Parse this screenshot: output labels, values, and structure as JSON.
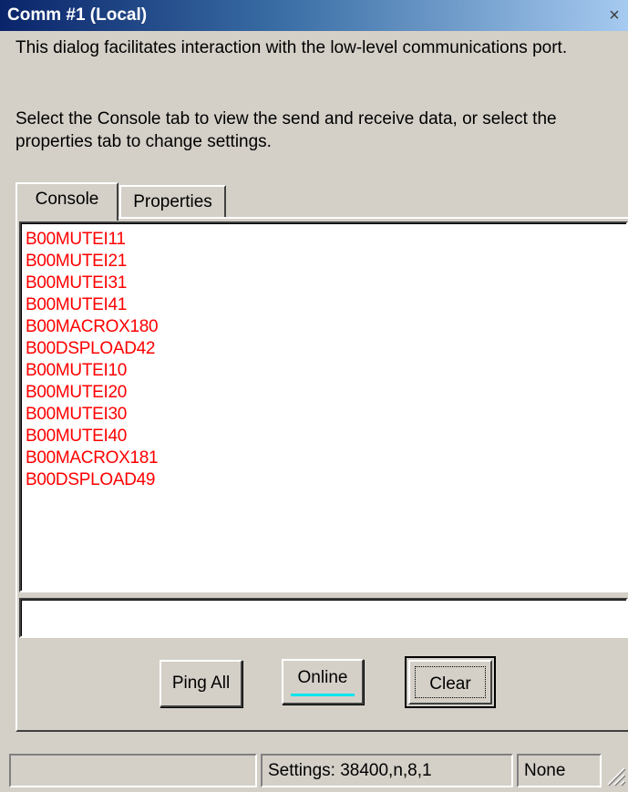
{
  "window": {
    "title": "Comm #1 (Local)",
    "close_glyph": "×"
  },
  "description": {
    "paragraph1": "This dialog facilitates interaction with the low-level communications port.",
    "paragraph2": "Select the Console tab to view the send and receive data, or select the properties tab to change settings."
  },
  "tabs": [
    {
      "label": "Console",
      "selected": true
    },
    {
      "label": "Properties",
      "selected": false
    }
  ],
  "console": {
    "text_color": "#ff0000",
    "lines": [
      "B00MUTEI11",
      "B00MUTEI21",
      "B00MUTEI31",
      "B00MUTEI41",
      "B00MACROX180",
      "B00DSPLOAD42",
      "B00MUTEI10",
      "B00MUTEI20",
      "B00MUTEI30",
      "B00MUTEI40",
      "B00MACROX181",
      "B00DSPLOAD49"
    ],
    "send_value": ""
  },
  "buttons": {
    "ping_all": "Ping All",
    "online": "Online",
    "online_indicator_color": "#00e5ee",
    "clear": "Clear"
  },
  "status_bar": {
    "pane1": "",
    "settings": "Settings: 38400,n,8,1",
    "handshake": "None"
  }
}
